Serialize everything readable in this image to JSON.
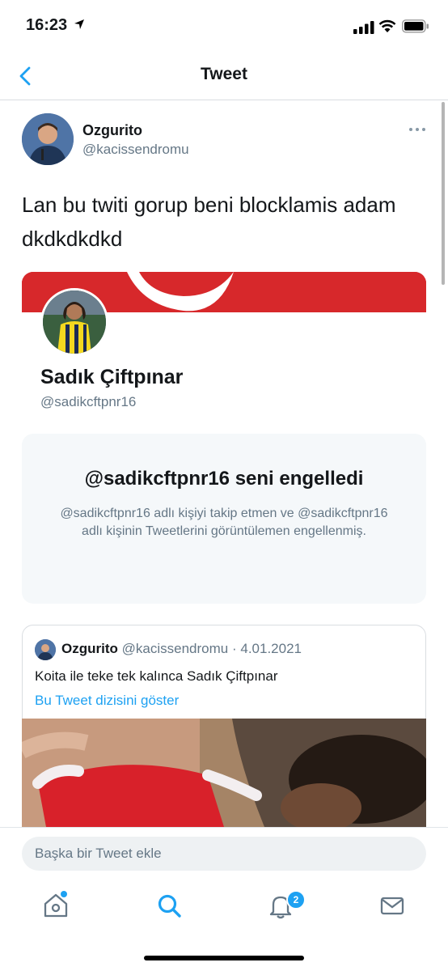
{
  "status_bar": {
    "time": "16:23"
  },
  "nav": {
    "title": "Tweet"
  },
  "tweet": {
    "author_name": "Ozgurito",
    "author_handle": "@kacissendromu",
    "text": "Lan bu twiti gorup beni blocklamis adam dkdkdkdkd"
  },
  "profile_card": {
    "name": "Sadık Çiftpınar",
    "handle": "@sadikcftpnr16",
    "blocked_title": "@sadikcftpnr16 seni engelledi",
    "blocked_description": "@sadikcftpnr16 adlı kişiyi takip etmen ve @sadikcftpnr16 adlı kişinin Tweetlerini görüntülemen engellenmiş."
  },
  "quoted_tweet": {
    "author_name": "Ozgurito",
    "author_handle": "@kacissendromu",
    "separator": "·",
    "date": "4.01.2021",
    "text": "Koita ile teke tek kalınca Sadık Çiftpınar",
    "thread_link": "Bu Tweet dizisini göster"
  },
  "reply": {
    "placeholder": "Başka bir Tweet ekle"
  },
  "tab_bar": {
    "items": [
      {
        "icon": "home-icon"
      },
      {
        "icon": "search-icon"
      },
      {
        "icon": "notifications-icon",
        "badge": "2"
      },
      {
        "icon": "messages-icon"
      }
    ]
  },
  "colors": {
    "accent": "#1da1f2",
    "flag_red": "#d7282b",
    "secondary_text": "#657786"
  }
}
